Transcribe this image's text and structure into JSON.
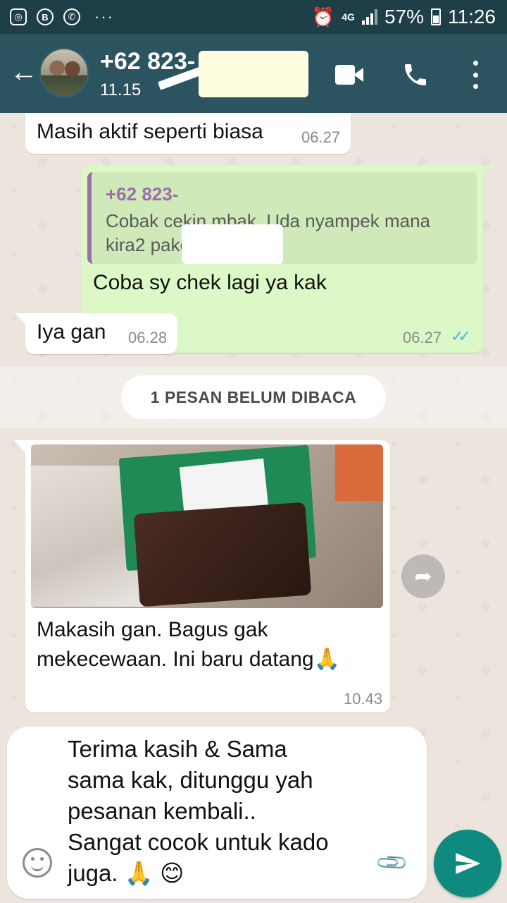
{
  "status_bar": {
    "left_icons": [
      "instagram-icon",
      "bbm-icon",
      "whatsapp-icon"
    ],
    "more": "···",
    "network": "4G",
    "battery": "57%",
    "time": "11:26"
  },
  "header": {
    "contact_name": "+62 823-",
    "subtitle": "11.15",
    "icons": [
      "back-arrow-icon",
      "video-call-icon",
      "phone-call-icon",
      "more-vert-icon"
    ]
  },
  "messages": [
    {
      "direction": "in",
      "text": "Masih aktif seperti biasa",
      "time": "06.27"
    },
    {
      "direction": "out",
      "quote": {
        "name": "+62 823-",
        "text": "Cobak cekin mbak. Uda nyampek mana kira2 paketanya"
      },
      "text": "Coba sy chek lagi ya kak",
      "time": "06.27",
      "status": "✓✓"
    },
    {
      "direction": "in",
      "text": "Iya gan",
      "time": "06.28"
    },
    {
      "direction": "in",
      "type": "image",
      "text": "Makasih gan. Bagus gak mekecewaan. Ini baru datang",
      "emoji": "🙏",
      "time": "10.43"
    }
  ],
  "unread_banner": "1 PESAN BELUM DIBACA",
  "composer": {
    "text": "Terima kasih & Sama\nsama kak, ditunggu yah\npesanan kembali..\nSangat cocok untuk kado\njuga. 🙏 😊"
  },
  "colors": {
    "status_bar": "#1f3f48",
    "app_bar": "#2c5360",
    "outgoing_bubble": "#dcf8c6",
    "send_button": "#0f8a7e",
    "read_ticks": "#4fb6ec",
    "quote_accent": "#9b6faa"
  }
}
